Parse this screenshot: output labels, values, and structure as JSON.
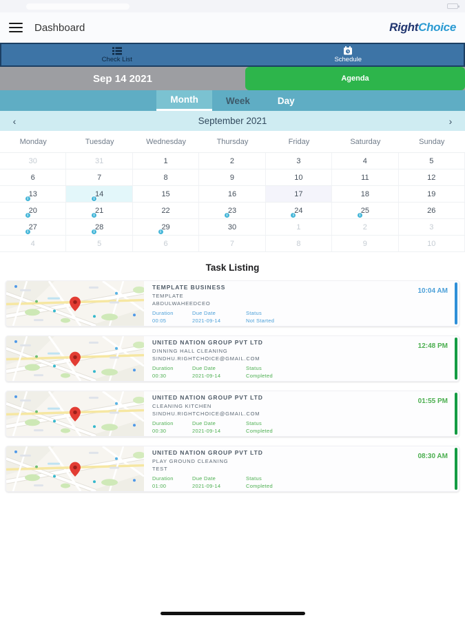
{
  "header": {
    "title": "Dashboard",
    "logo_part1": "Right",
    "logo_part2": "Choice"
  },
  "main_tabs": {
    "check_list": "Check List",
    "schedule": "Schedule"
  },
  "date_bar": {
    "date": "Sep 14 2021",
    "agenda_label": "Agenda"
  },
  "view_tabs": [
    {
      "label": "Month",
      "selected": true
    },
    {
      "label": "Week",
      "selected": false
    },
    {
      "label": "Day",
      "selected": false
    }
  ],
  "calendar": {
    "nav_title": "September 2021",
    "prev_arrow": "‹",
    "next_arrow": "›",
    "day_headers": [
      "Monday",
      "Tuesday",
      "Wednesday",
      "Thursday",
      "Friday",
      "Saturday",
      "Sunday"
    ],
    "weeks": [
      [
        {
          "d": "30",
          "muted": true
        },
        {
          "d": "31",
          "muted": true
        },
        {
          "d": "1"
        },
        {
          "d": "2"
        },
        {
          "d": "3"
        },
        {
          "d": "4"
        },
        {
          "d": "5"
        }
      ],
      [
        {
          "d": "6"
        },
        {
          "d": "7"
        },
        {
          "d": "8"
        },
        {
          "d": "9"
        },
        {
          "d": "10"
        },
        {
          "d": "11"
        },
        {
          "d": "12"
        }
      ],
      [
        {
          "d": "13",
          "badge": true
        },
        {
          "d": "14",
          "badge": true,
          "selected": true
        },
        {
          "d": "15"
        },
        {
          "d": "16"
        },
        {
          "d": "17",
          "today": true
        },
        {
          "d": "18"
        },
        {
          "d": "19"
        }
      ],
      [
        {
          "d": "20",
          "badge": true
        },
        {
          "d": "21",
          "badge": true
        },
        {
          "d": "22"
        },
        {
          "d": "23",
          "badge": true
        },
        {
          "d": "24",
          "badge": true
        },
        {
          "d": "25",
          "badge": true
        },
        {
          "d": "26"
        }
      ],
      [
        {
          "d": "27",
          "badge": true
        },
        {
          "d": "28",
          "badge": true
        },
        {
          "d": "29",
          "badge": true
        },
        {
          "d": "30"
        },
        {
          "d": "1",
          "muted": true
        },
        {
          "d": "2",
          "muted": true
        },
        {
          "d": "3",
          "muted": true
        }
      ],
      [
        {
          "d": "4",
          "muted": true
        },
        {
          "d": "5",
          "muted": true
        },
        {
          "d": "6",
          "muted": true
        },
        {
          "d": "7",
          "muted": true
        },
        {
          "d": "8",
          "muted": true
        },
        {
          "d": "9",
          "muted": true
        },
        {
          "d": "10",
          "muted": true
        }
      ]
    ],
    "badge_glyph": "i"
  },
  "task_listing": {
    "title": "Task Listing",
    "meta_labels": {
      "duration": "Duration",
      "due_date": "Due Date",
      "status": "Status"
    },
    "tasks": [
      {
        "company": "TEMPLATE BUSINESS",
        "task": "TEMPLATE",
        "assignee": "ABDULWAHEEDCEO",
        "duration": "00:05",
        "due_date": "2021-09-14",
        "status": "Not Started",
        "time": "10:04 AM",
        "accent_text": "#4a9fd8",
        "accent_bar": "#2e8fd8"
      },
      {
        "company": "UNITED NATION GROUP PVT LTD",
        "task": "DINNING HALL CLEANING",
        "assignee": "SINDHU.RIGHTCHOICE@GMAIL.COM",
        "duration": "00:30",
        "due_date": "2021-09-14",
        "status": "Completed",
        "time": "12:48 PM",
        "accent_text": "#4caf50",
        "accent_bar": "#149c43"
      },
      {
        "company": "UNITED NATION GROUP PVT LTD",
        "task": "CLEANING KITCHEN",
        "assignee": "SINDHU.RIGHTCHOICE@GMAIL.COM",
        "duration": "00:30",
        "due_date": "2021-09-14",
        "status": "Completed",
        "time": "01:55 PM",
        "accent_text": "#4caf50",
        "accent_bar": "#149c43"
      },
      {
        "company": "UNITED NATION GROUP PVT LTD",
        "task": "PLAY GROUND CLEANING",
        "assignee": "TEST",
        "duration": "01:00",
        "due_date": "2021-09-14",
        "status": "Completed",
        "time": "08:30 AM",
        "accent_text": "#4caf50",
        "accent_bar": "#149c43"
      }
    ]
  },
  "colors": {
    "main_tab_bar": "#3d74a6",
    "main_tab_border": "#1c3f63",
    "date_gray": "#9d9ea2",
    "agenda_green": "#2db54b",
    "view_tab_bar": "#5fadc4",
    "view_tab_selected": "#7bc2d1",
    "cal_nav": "#cfecf2",
    "badge": "#45b6d8",
    "selected_day_bg": "#e3f7fa",
    "today_bg": "#f4f4fb"
  }
}
